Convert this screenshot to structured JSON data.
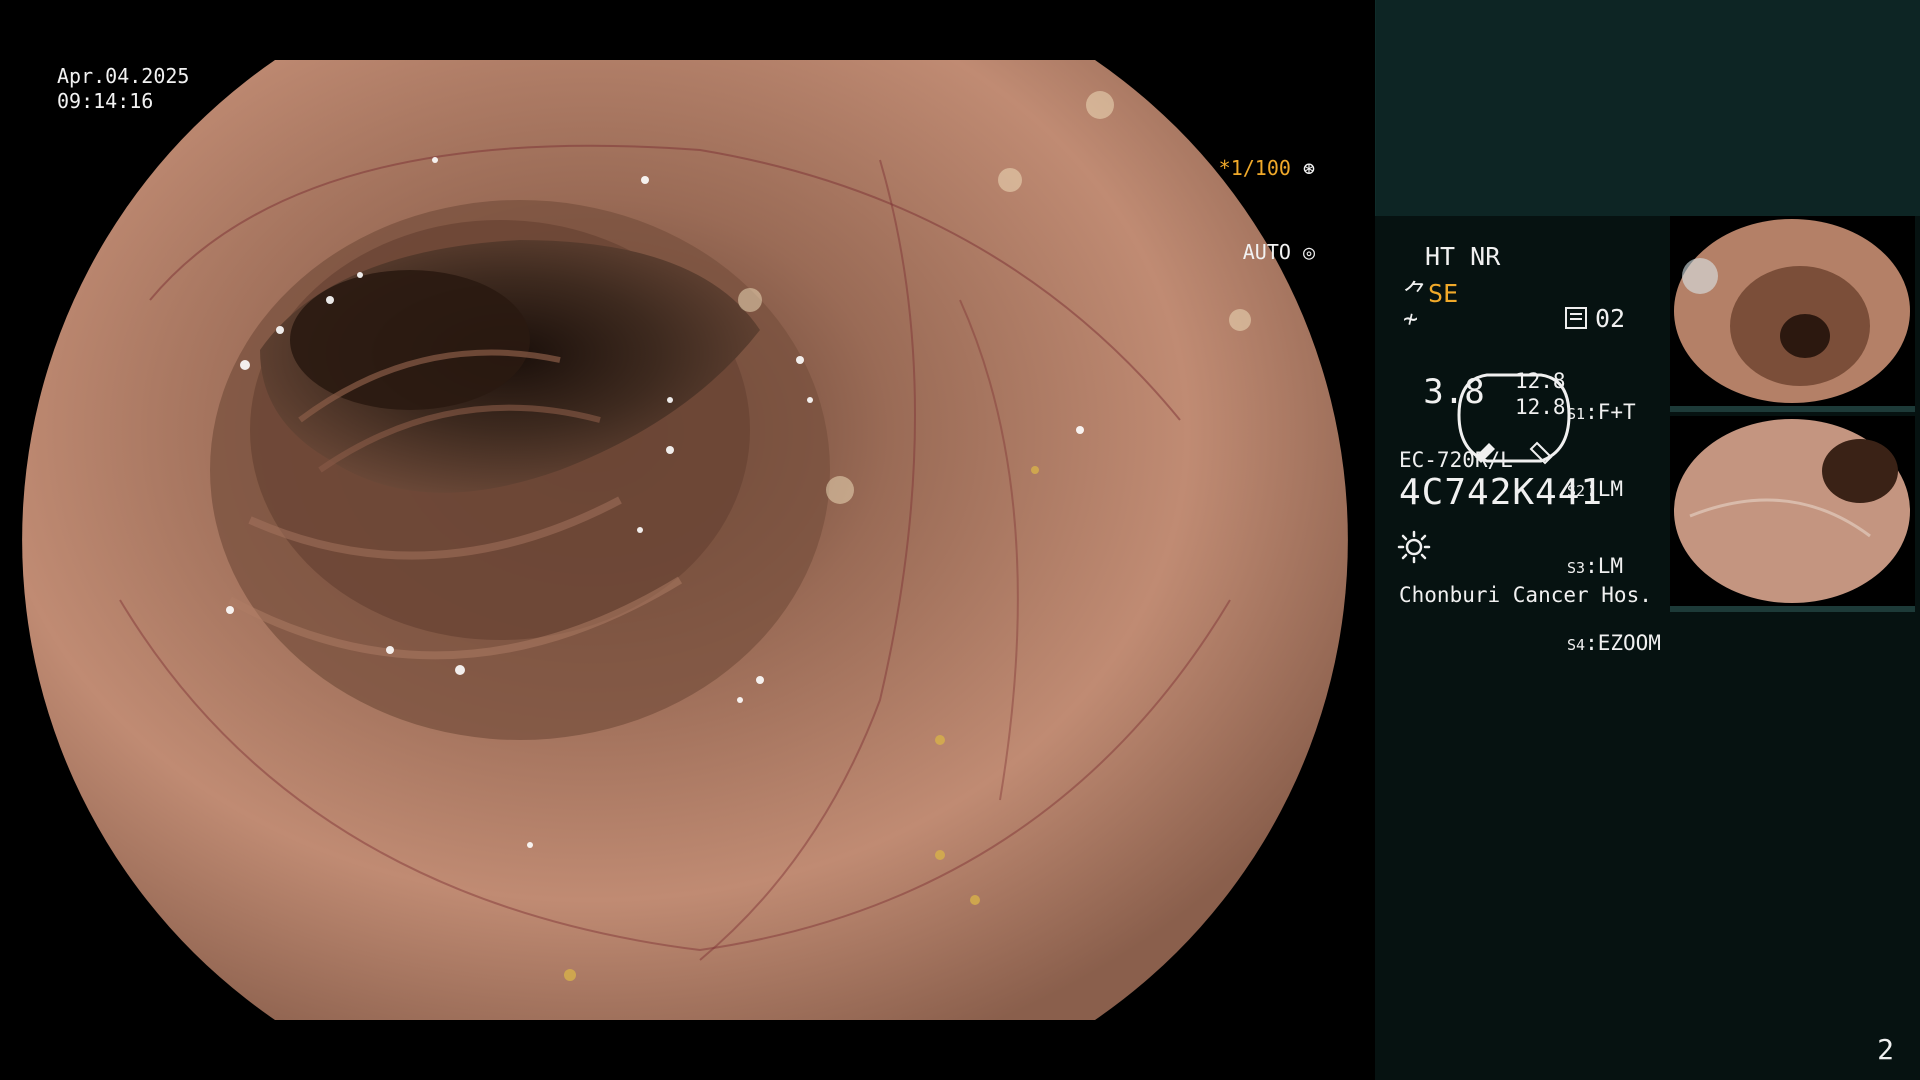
{
  "scope": {
    "date": "Apr.04.2025",
    "time": "09:14:16",
    "shutter_label": "*1/100",
    "exposure_label": "AUTO"
  },
  "panel": {
    "ht_nr": "HT NR",
    "se_label": "SE",
    "sharp_symbol": "≁",
    "memory_label": "02",
    "gauge_value": "3.8",
    "scale_values": [
      "12.8",
      "12.8"
    ],
    "s_settings": [
      {
        "key": "S1",
        "value": "F+T"
      },
      {
        "key": "S2",
        "value": "LM"
      },
      {
        "key": "S3",
        "value": "LM"
      },
      {
        "key": "S4",
        "value": "EZOOM"
      }
    ],
    "model": "EC-720R/L",
    "serial": "4C742K441",
    "hospital": "Chonburi Cancer Hos.",
    "page_number": "2"
  },
  "colors": {
    "background": "#000000",
    "panel_bg": "#061211",
    "panel_top_bg": "#0d2524",
    "accent": "#f0a92a",
    "text": "#f0f0f0"
  },
  "icons": [
    "shutter-icon",
    "auto-exposure-icon",
    "memory-icon",
    "light-sun-icon",
    "gauge-icon"
  ]
}
